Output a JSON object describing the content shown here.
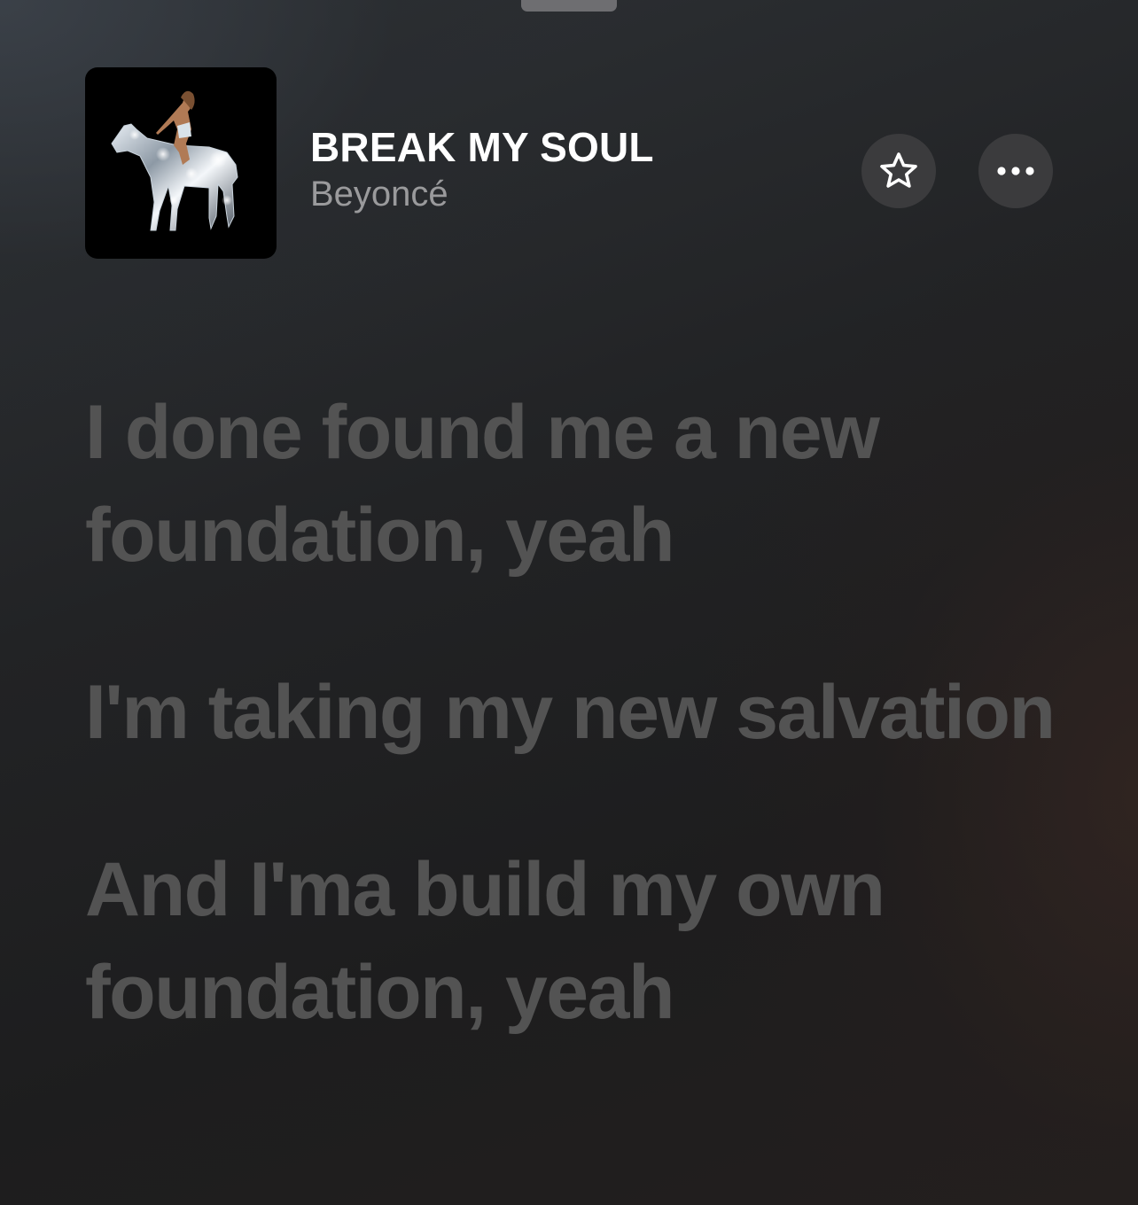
{
  "song": {
    "title": "BREAK MY SOUL",
    "artist": "Beyoncé"
  },
  "icons": {
    "favorite": "star-icon",
    "more": "ellipsis-icon",
    "artwork": "album-artwork"
  },
  "lyrics": [
    "I done found me a new foundation, yeah",
    "I'm taking my new salvation",
    "And I'ma build my own foundation, yeah"
  ],
  "colors": {
    "background": "#212224",
    "title": "#ffffff",
    "artist": "#9a9a9c",
    "lyric_inactive": "#535353",
    "button_bg": "#3b3b3d"
  }
}
